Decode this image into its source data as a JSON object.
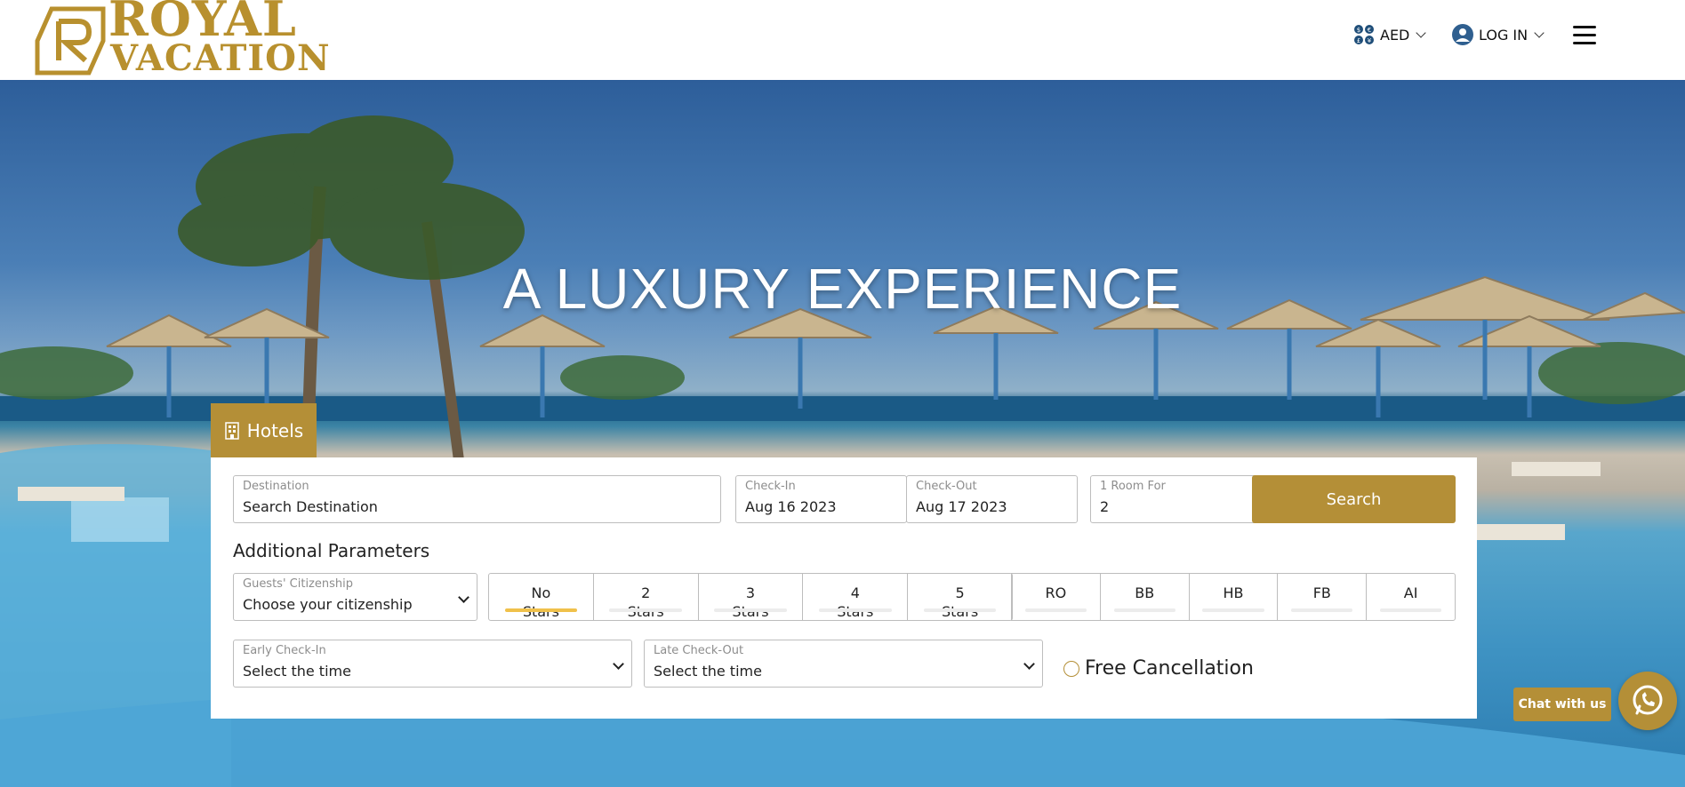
{
  "brand": {
    "line1": "ROYAL",
    "line2": "VACATION",
    "color": "#b8902e"
  },
  "header": {
    "currency": "AED",
    "login": "LOG IN",
    "menu_icon": "hamburger-icon",
    "currency_icon": "currency-exchange-icon",
    "user_icon": "user-avatar-icon"
  },
  "hero": {
    "title": "A LUXURY EXPERIENCE"
  },
  "search": {
    "tab_label": "Hotels",
    "tab_icon": "building-icon",
    "destination": {
      "label": "Destination",
      "value": "Search Destination"
    },
    "checkin": {
      "label": "Check-In",
      "value": "Aug 16 2023"
    },
    "checkout": {
      "label": "Check-Out",
      "value": "Aug 17 2023"
    },
    "rooms": {
      "label": "1 Room For",
      "value": "2"
    },
    "search_button": "Search",
    "additional_title": "Additional Parameters",
    "citizenship": {
      "label": "Guests' Citizenship",
      "value": "Choose your citizenship"
    },
    "stars": [
      {
        "top": "No",
        "bottom": "Stars",
        "active": true
      },
      {
        "top": "2",
        "bottom": "Stars",
        "active": false
      },
      {
        "top": "3",
        "bottom": "Stars",
        "active": false
      },
      {
        "top": "4",
        "bottom": "Stars",
        "active": false
      },
      {
        "top": "5",
        "bottom": "Stars",
        "active": false
      }
    ],
    "board": [
      {
        "label": "RO"
      },
      {
        "label": "BB"
      },
      {
        "label": "HB"
      },
      {
        "label": "FB"
      },
      {
        "label": "AI"
      }
    ],
    "early_checkin": {
      "label": "Early Check-In",
      "value": "Select the time"
    },
    "late_checkout": {
      "label": "Late Check-Out",
      "value": "Select the time"
    },
    "free_cancellation": "Free Cancellation"
  },
  "chat": {
    "label": "Chat with us",
    "icon": "whatsapp-icon"
  },
  "colors": {
    "accent": "#b48f37",
    "active_bar": "#f0c14b"
  }
}
